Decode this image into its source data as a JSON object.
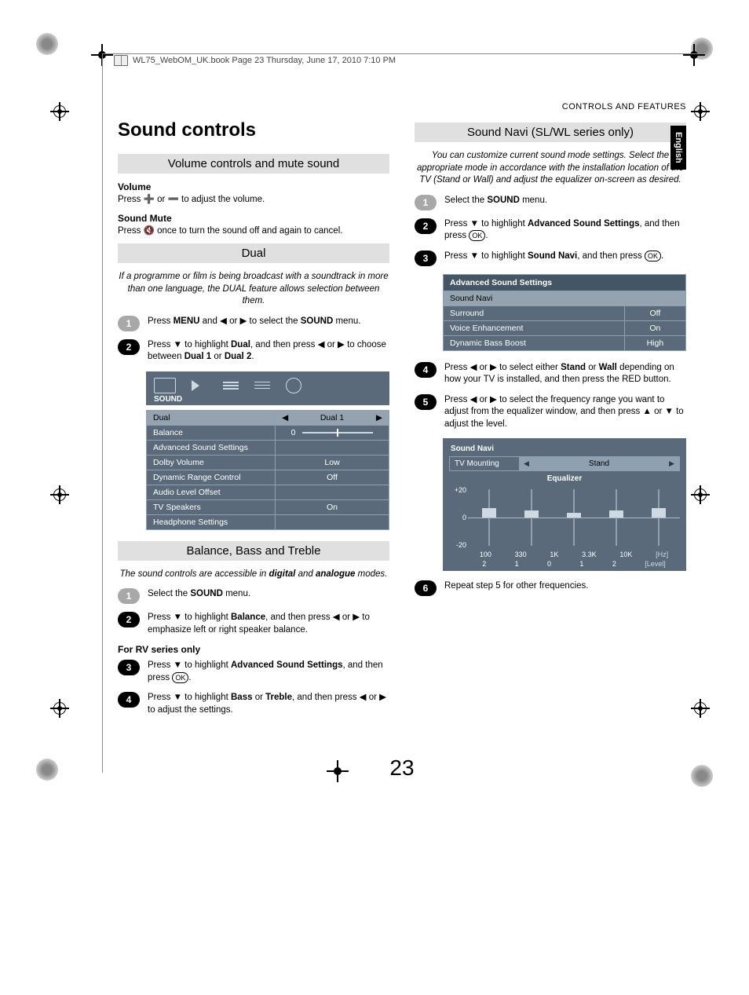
{
  "book_header": "WL75_WebOM_UK.book  Page 23  Thursday, June 17, 2010  7:10 PM",
  "header_right": "CONTROLS AND FEATURES",
  "lang_tab": "English",
  "page_number": "23",
  "left": {
    "title": "Sound controls",
    "section1": {
      "bar": "Volume controls and mute sound",
      "vol_label": "Volume",
      "vol_text": "Press ➕ or ➖ to adjust the volume.",
      "mute_label": "Sound Mute",
      "mute_text": "Press 🔇 once to turn the sound off and again to cancel."
    },
    "section2": {
      "bar": "Dual",
      "intro": "If a programme or film is being broadcast with a soundtrack in more than one language, the DUAL feature allows selection between them.",
      "step1_pre": "Press ",
      "step1_b1": "MENU",
      "step1_mid": " and ◀ or ▶ to select the ",
      "step1_b2": "SOUND",
      "step1_post": " menu.",
      "step2_pre": "Press ▼ to highlight ",
      "step2_b1": "Dual",
      "step2_mid": ", and then press ◀ or ▶ to choose between ",
      "step2_b2": "Dual 1",
      "step2_or": " or ",
      "step2_b3": "Dual 2",
      "step2_post": ".",
      "menu": {
        "label": "SOUND",
        "rows": [
          {
            "k": "Dual",
            "v": "Dual 1",
            "light": true,
            "arrows": true
          },
          {
            "k": "Balance",
            "v": "0",
            "slider": true
          },
          {
            "k": "Advanced Sound Settings",
            "v": ""
          },
          {
            "k": "Dolby Volume",
            "v": "Low"
          },
          {
            "k": "Dynamic Range Control",
            "v": "Off"
          },
          {
            "k": "Audio Level Offset",
            "v": ""
          },
          {
            "k": "TV Speakers",
            "v": "On"
          },
          {
            "k": "Headphone Settings",
            "v": ""
          }
        ]
      }
    },
    "section3": {
      "bar": "Balance, Bass and Treble",
      "intro_pre": "The sound controls are accessible in ",
      "intro_b1": "digital",
      "intro_mid": " and ",
      "intro_b2": "analogue",
      "intro_post": " modes.",
      "step1_pre": "Select the ",
      "step1_b1": "SOUND",
      "step1_post": " menu.",
      "step2_pre": "Press ▼ to highlight ",
      "step2_b1": "Balance",
      "step2_post": ", and then press ◀ or ▶ to emphasize left or right speaker balance.",
      "rv_label": "For RV series only",
      "step3_pre": "Press ▼ to highlight ",
      "step3_b1": "Advanced Sound Settings",
      "step3_post": ", and then press ",
      "step3_ok": "OK",
      "step3_dot": ".",
      "step4_pre": "Press ▼ to highlight ",
      "step4_b1": "Bass",
      "step4_or": " or ",
      "step4_b2": "Treble",
      "step4_post": ", and then press ◀ or ▶ to adjust the settings."
    }
  },
  "right": {
    "bar": "Sound Navi (SL/WL series only)",
    "intro": "You can customize current sound mode settings. Select the appropriate mode in accordance with the installation location of the TV (Stand or Wall) and adjust the equalizer on-screen as desired.",
    "step1_pre": "Select the ",
    "step1_b1": "SOUND",
    "step1_post": " menu.",
    "step2_pre": "Press ▼ to highlight ",
    "step2_b1": "Advanced Sound Settings",
    "step2_post": ", and then press ",
    "step2_ok": "OK",
    "step2_dot": ".",
    "step3_pre": "Press ▼ to highlight ",
    "step3_b1": "Sound Navi",
    "step3_post": ", and then press ",
    "step3_ok": "OK",
    "step3_dot": ".",
    "menu": {
      "title": "Advanced Sound Settings",
      "subtitle": "Sound Navi",
      "rows": [
        {
          "k": "Surround",
          "v": "Off"
        },
        {
          "k": "Voice Enhancement",
          "v": "On"
        },
        {
          "k": "Dynamic Bass Boost",
          "v": "High"
        }
      ]
    },
    "step4_pre": "Press ◀ or ▶ to select either ",
    "step4_b1": "Stand",
    "step4_or": " or ",
    "step4_b2": "Wall",
    "step4_post": " depending on how your TV is installed, and then press the RED button.",
    "step5": "Press ◀ or ▶ to select the frequency range you want to adjust from the equalizer window, and then press ▲ or ▼ to adjust the level.",
    "eq": {
      "title": "Sound Navi",
      "mount_label": "TV Mounting",
      "mount_val": "Stand",
      "sub": "Equalizer",
      "y": [
        "+20",
        "0",
        "-20"
      ],
      "hz": [
        "100",
        "330",
        "1K",
        "3.3K",
        "10K",
        "[Hz]"
      ],
      "lev": [
        "2",
        "1",
        "0",
        "1",
        "2",
        "[Level]"
      ]
    },
    "step6": "Repeat step 5 for other frequencies."
  },
  "chart_data": {
    "type": "bar",
    "title": "Equalizer",
    "categories_hz": [
      "100",
      "330",
      "1K",
      "3.3K",
      "10K"
    ],
    "levels": [
      2,
      1,
      0,
      1,
      2
    ],
    "ylim": [
      -20,
      20
    ],
    "ylabel": "",
    "xlabel": "[Hz]",
    "secondary_xlabel": "[Level]"
  }
}
